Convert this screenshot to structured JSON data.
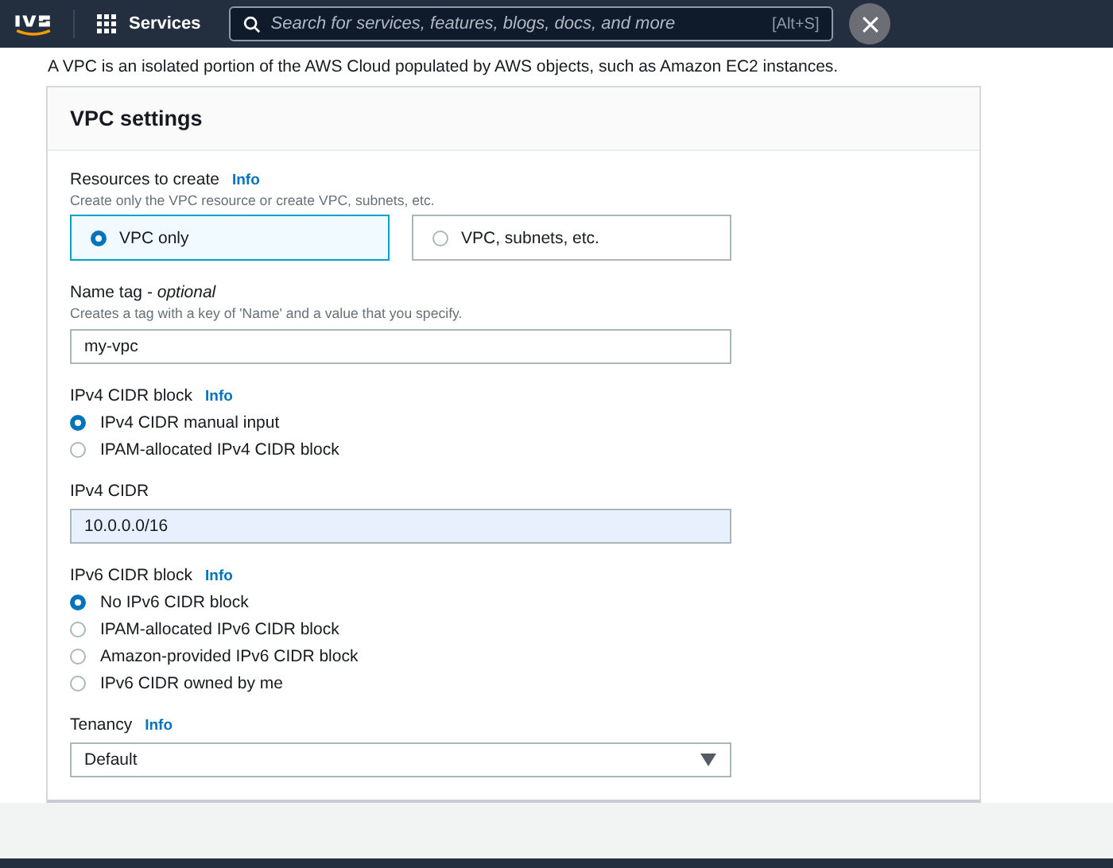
{
  "top_bar": {
    "services_label": "Services",
    "search": {
      "placeholder": "Search for services, features, blogs, docs, and more",
      "shortcut": "[Alt+S]"
    }
  },
  "description": "A VPC is an isolated portion of the AWS Cloud populated by AWS objects, such as Amazon EC2 instances.",
  "panel": {
    "title": "VPC settings",
    "sections": [
      {
        "kind": "tiles",
        "label": "Resources to create",
        "info": "Info",
        "hint": "Create only the VPC resource or create VPC, subnets, etc.",
        "options": [
          {
            "label": "VPC only",
            "selected": true
          },
          {
            "label": "VPC, subnets, etc.",
            "selected": false
          }
        ]
      },
      {
        "kind": "input",
        "label": "Name tag - *optional*",
        "hint": "Creates a tag with a key of 'Name' and a value that you specify.",
        "value": "my-vpc",
        "highlighted": false
      },
      {
        "kind": "radios",
        "label": "IPv4 CIDR block",
        "info": "Info",
        "options": [
          {
            "label": "IPv4 CIDR manual input",
            "selected": true
          },
          {
            "label": "IPAM-allocated IPv4 CIDR block",
            "selected": false
          }
        ]
      },
      {
        "kind": "input",
        "label": "IPv4 CIDR",
        "value": "10.0.0.0/16",
        "highlighted": true
      },
      {
        "kind": "radios",
        "label": "IPv6 CIDR block",
        "info": "Info",
        "options": [
          {
            "label": "No IPv6 CIDR block",
            "selected": true
          },
          {
            "label": "IPAM-allocated IPv6 CIDR block",
            "selected": false
          },
          {
            "label": "Amazon-provided IPv6 CIDR block",
            "selected": false
          },
          {
            "label": "IPv6 CIDR owned by me",
            "selected": false
          }
        ]
      },
      {
        "kind": "select",
        "label": "Tenancy",
        "info": "Info",
        "value": "Default"
      }
    ]
  }
}
